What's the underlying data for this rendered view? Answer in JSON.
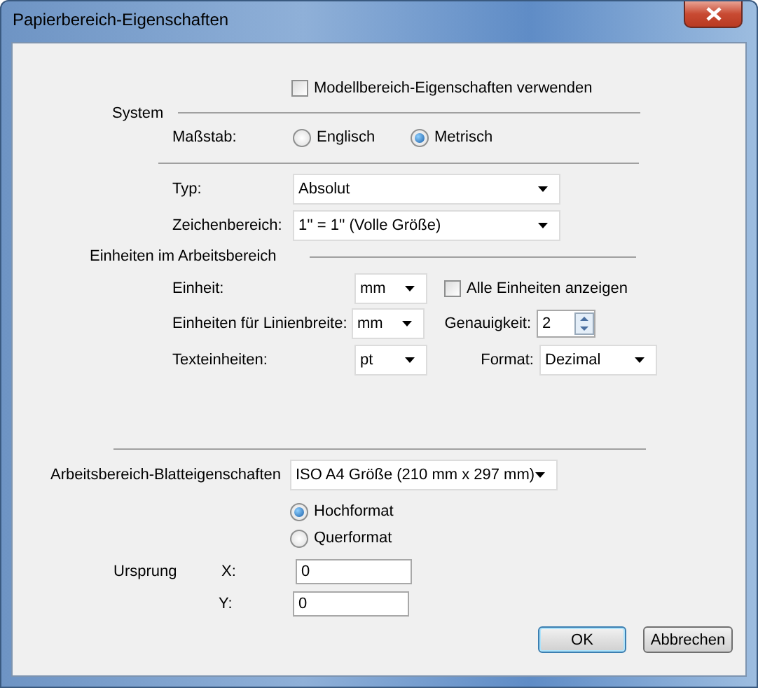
{
  "window": {
    "title": "Papierbereich-Eigenschaften"
  },
  "use_model_properties": {
    "label": "Modellbereich-Eigenschaften verwenden",
    "checked": false
  },
  "system": {
    "heading": "System",
    "scale_label": "Maßstab:",
    "scale_options": [
      {
        "label": "Englisch",
        "selected": false
      },
      {
        "label": "Metrisch",
        "selected": true
      }
    ],
    "type": {
      "label": "Typ:",
      "value": "Absolut"
    },
    "drawing_scale": {
      "label": "Zeichenbereich:",
      "value": "1'' = 1'' (Volle Größe)"
    }
  },
  "units": {
    "heading": "Einheiten im Arbeitsbereich",
    "unit": {
      "label": "Einheit:",
      "value": "mm"
    },
    "line_width_unit": {
      "label": "Einheiten für Linienbreite:",
      "value": "mm"
    },
    "text_unit": {
      "label": "Texteinheiten:",
      "value": "pt"
    },
    "show_all": {
      "label": "Alle Einheiten anzeigen",
      "checked": false
    },
    "precision": {
      "label": "Genauigkeit:",
      "value": "2"
    },
    "format": {
      "label": "Format:",
      "value": "Dezimal"
    }
  },
  "sheet": {
    "label": "Arbeitsbereich-Blatteigenschaften",
    "value": "ISO A4 Größe (210 mm x 297 mm)"
  },
  "orientation": [
    {
      "label": "Hochformat",
      "selected": true
    },
    {
      "label": "Querformat",
      "selected": false
    }
  ],
  "origin": {
    "label": "Ursprung",
    "x": {
      "label": "X:",
      "value": "0"
    },
    "y": {
      "label": "Y:",
      "value": "0"
    }
  },
  "buttons": [
    {
      "label": "OK",
      "default": true
    },
    {
      "label": "Abbrechen",
      "default": false
    }
  ]
}
